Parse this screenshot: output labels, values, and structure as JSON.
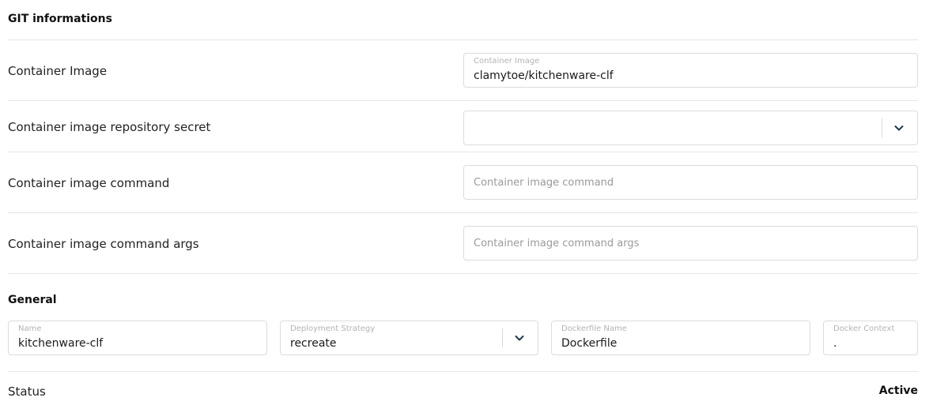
{
  "git_section": {
    "title": "GIT informations",
    "container_image": {
      "label": "Container Image",
      "field_label": "Container Image",
      "value": "clamytoe/kitchenware-clf"
    },
    "repository_secret": {
      "label": "Container image repository secret",
      "value": "",
      "icon": "chevron-down-icon"
    },
    "image_command": {
      "label": "Container image command",
      "placeholder": "Container image command"
    },
    "image_command_args": {
      "label": "Container image command args",
      "placeholder": "Container image command args"
    }
  },
  "general_section": {
    "title": "General",
    "name": {
      "field_label": "Name",
      "value": "kitchenware-clf"
    },
    "deployment_strategy": {
      "field_label": "Deployment Strategy",
      "value": "recreate",
      "icon": "chevron-down-icon"
    },
    "dockerfile_name": {
      "field_label": "Dockerfile Name",
      "value": "Dockerfile"
    },
    "docker_context": {
      "field_label": "Docker Context",
      "value": "."
    }
  },
  "status": {
    "label": "Status",
    "value": "Active"
  },
  "colors": {
    "chevron": "#1f3a4d",
    "border": "#dcdcdc",
    "divider": "#e6e6e6"
  }
}
